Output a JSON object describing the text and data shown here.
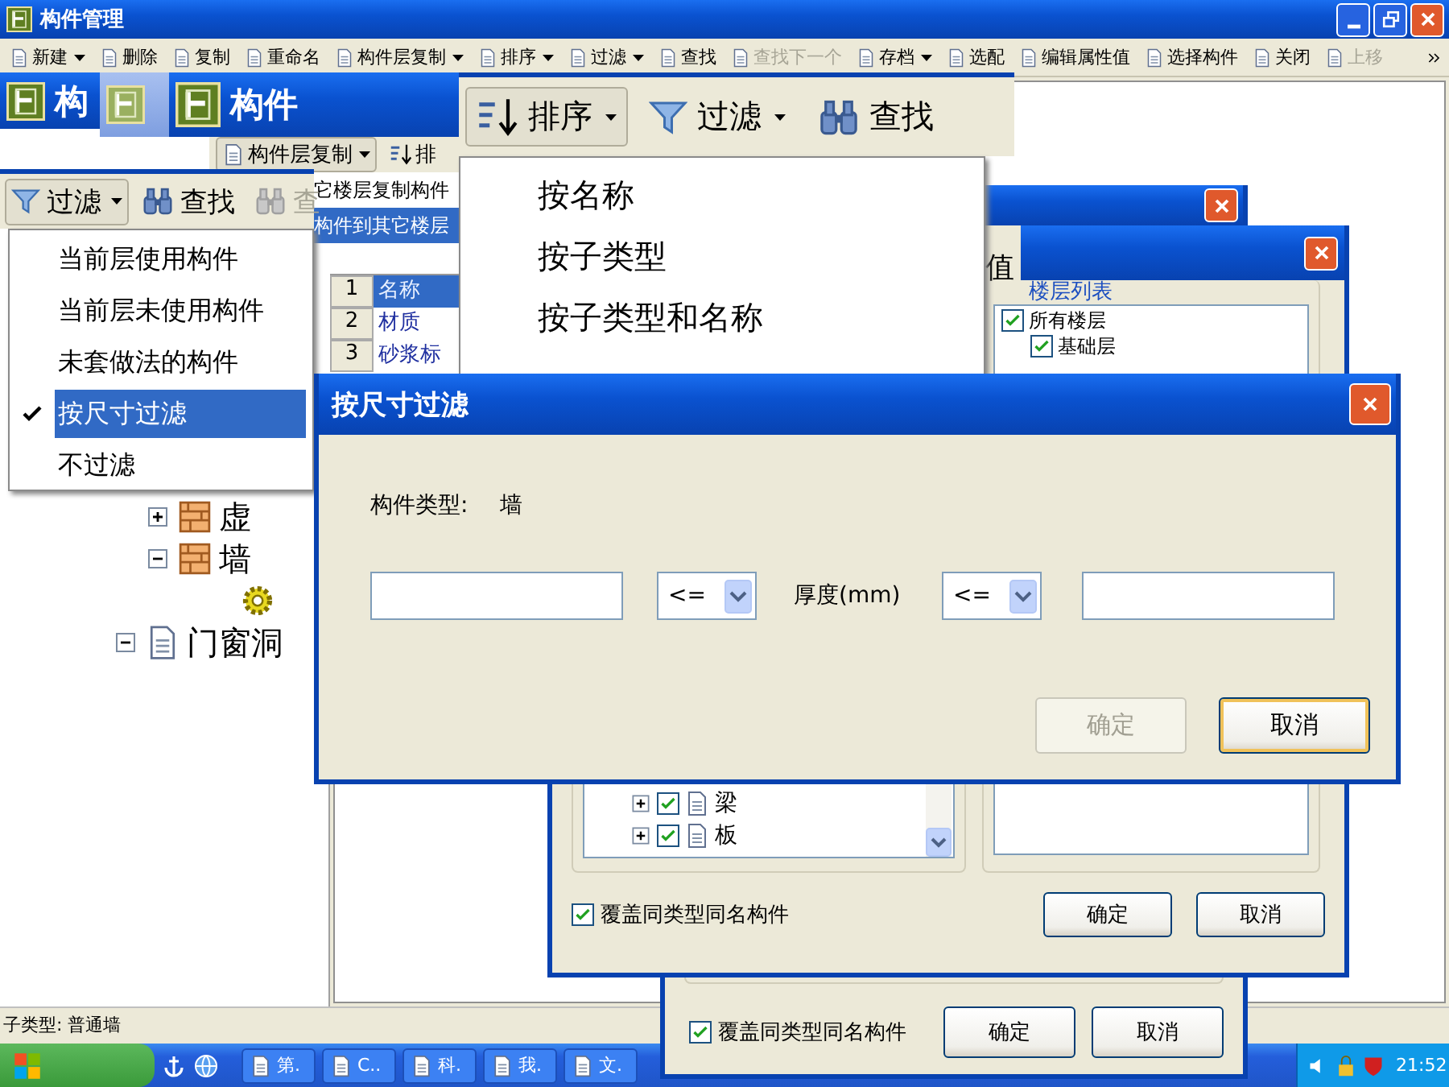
{
  "main_window": {
    "title": "构件管理",
    "toolbar": [
      {
        "label": "新建",
        "dropdown": true,
        "disabled": false
      },
      {
        "label": "删除",
        "dropdown": false,
        "disabled": false
      },
      {
        "label": "复制",
        "dropdown": false,
        "disabled": false
      },
      {
        "label": "重命名",
        "dropdown": false,
        "disabled": false
      },
      {
        "label": "构件层复制",
        "dropdown": true,
        "disabled": false
      },
      {
        "label": "排序",
        "dropdown": true,
        "disabled": false
      },
      {
        "label": "过滤",
        "dropdown": true,
        "disabled": false
      },
      {
        "label": "查找",
        "dropdown": false,
        "disabled": false
      },
      {
        "label": "查找下一个",
        "dropdown": false,
        "disabled": true
      },
      {
        "label": "存档",
        "dropdown": true,
        "disabled": false
      },
      {
        "label": "选配",
        "dropdown": false,
        "disabled": false
      },
      {
        "label": "编辑属性值",
        "dropdown": false,
        "disabled": false
      },
      {
        "label": "选择构件",
        "dropdown": false,
        "disabled": false
      },
      {
        "label": "关闭",
        "dropdown": false,
        "disabled": false
      },
      {
        "label": "上移",
        "dropdown": false,
        "disabled": true
      }
    ],
    "tree": [
      {
        "children": [
          {
            "label": "虚",
            "expanded": false
          },
          {
            "label": "墙",
            "expanded": true,
            "children": [
              {
                "kind": "gear"
              }
            ]
          }
        ]
      },
      {
        "label": "门窗洞",
        "expanded": true
      }
    ],
    "status_bar": "子类型: 普通墙"
  },
  "title_strip": {
    "fragments": [
      {
        "text": "构",
        "active": true
      },
      {
        "active": false
      },
      {
        "text": "构件",
        "active": true
      }
    ]
  },
  "copy_strip": {
    "toolbar": [
      {
        "label": "构件层复制",
        "dropdown": true
      },
      {
        "label": "排",
        "dropdown": false
      }
    ],
    "menu": [
      {
        "label": "它楼层复制构件",
        "selected": false
      },
      {
        "label": "构件到其它楼层",
        "selected": true
      }
    ],
    "grid": [
      {
        "index": "1",
        "value": "名称",
        "selected": true
      },
      {
        "index": "2",
        "value": "材质",
        "selected": false
      },
      {
        "index": "3",
        "value": "砂浆标",
        "selected": false
      }
    ]
  },
  "sort_strip": {
    "buttons": [
      {
        "label": "排序",
        "dropdown": true,
        "pressed": true
      },
      {
        "label": "过滤",
        "dropdown": true,
        "pressed": false
      },
      {
        "label": "查找",
        "dropdown": false,
        "pressed": false
      }
    ],
    "menu": [
      {
        "label": "按名称"
      },
      {
        "label": "按子类型"
      },
      {
        "label": "按子类型和名称"
      }
    ]
  },
  "filter_strip": {
    "buttons": [
      {
        "label": "过滤",
        "dropdown": true,
        "pressed": true,
        "disabled": false
      },
      {
        "label": "查找",
        "dropdown": false,
        "pressed": false,
        "disabled": false
      },
      {
        "label": "查",
        "dropdown": false,
        "pressed": false,
        "disabled": true
      }
    ],
    "menu": [
      {
        "label": "当前层使用构件",
        "checked": false,
        "selected": false
      },
      {
        "label": "当前层未使用构件",
        "checked": false,
        "selected": false
      },
      {
        "label": "未套做法的构件",
        "checked": false,
        "selected": false
      },
      {
        "label": "按尺寸过滤",
        "checked": true,
        "selected": true
      },
      {
        "label": "不过滤",
        "checked": false,
        "selected": false
      }
    ]
  },
  "copy_dialog_back": {
    "fragment": "值",
    "override": {
      "label": "覆盖同类型同名构件",
      "checked": true
    },
    "buttons": [
      "确定",
      "取消"
    ]
  },
  "copy_dialog_front": {
    "floor_group": {
      "title": "楼层列表",
      "floors": [
        {
          "label": "所有楼层",
          "checked": true,
          "children": [
            {
              "label": "基础层",
              "checked": true
            }
          ]
        }
      ]
    },
    "components": [
      {
        "label": "梁",
        "checked": true,
        "expanded": false
      },
      {
        "label": "板",
        "checked": true,
        "expanded": false
      }
    ],
    "override": {
      "label": "覆盖同类型同名构件",
      "checked": true
    },
    "buttons": [
      "确定",
      "取消"
    ]
  },
  "size_filter_dialog": {
    "title": "按尺寸过滤",
    "type_label": "构件类型:",
    "type_value": "墙",
    "min_operator": "<=",
    "dimension": "厚度(mm)",
    "max_operator": "<=",
    "buttons": [
      {
        "label": "确定",
        "disabled": true,
        "default": false
      },
      {
        "label": "取消",
        "disabled": false,
        "default": true
      }
    ]
  },
  "taskbar": {
    "tasks": [
      "第.",
      "C..",
      "科.",
      "我.",
      "文."
    ],
    "clock": "21:52"
  }
}
